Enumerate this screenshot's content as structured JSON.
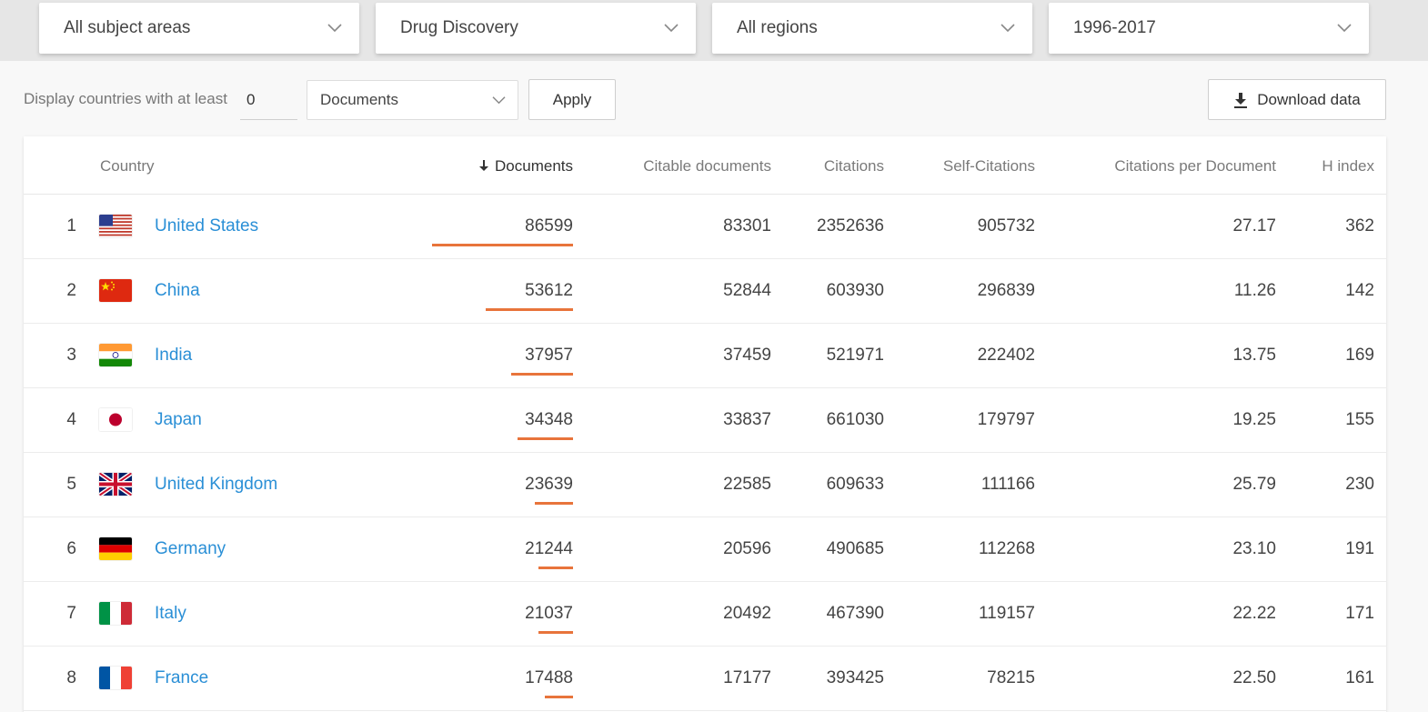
{
  "filters": {
    "subject_area": "All subject areas",
    "subject_category": "Drug Discovery",
    "region": "All regions",
    "period": "1996-2017"
  },
  "controls": {
    "min_label": "Display countries with at least",
    "min_value": "0",
    "metric": "Documents",
    "apply_label": "Apply",
    "download_label": "Download data"
  },
  "colors": {
    "accent_bar": "#e8743b",
    "link": "#2a8fd6"
  },
  "table": {
    "headers": {
      "country": "Country",
      "documents": "Documents",
      "citable": "Citable documents",
      "citations": "Citations",
      "self_citations": "Self-Citations",
      "cites_per_doc": "Citations per Document",
      "h_index": "H index"
    },
    "sort": {
      "column": "documents",
      "direction": "descending",
      "icon": "arrow-down-icon"
    },
    "rows": [
      {
        "rank": "1",
        "country": "United States",
        "flag": "us-flag-icon",
        "documents": "86599",
        "citable": "83301",
        "citations": "2352636",
        "self_citations": "905732",
        "cites_per_doc": "27.17",
        "h_index": "362"
      },
      {
        "rank": "2",
        "country": "China",
        "flag": "cn-flag-icon",
        "documents": "53612",
        "citable": "52844",
        "citations": "603930",
        "self_citations": "296839",
        "cites_per_doc": "11.26",
        "h_index": "142"
      },
      {
        "rank": "3",
        "country": "India",
        "flag": "in-flag-icon",
        "documents": "37957",
        "citable": "37459",
        "citations": "521971",
        "self_citations": "222402",
        "cites_per_doc": "13.75",
        "h_index": "169"
      },
      {
        "rank": "4",
        "country": "Japan",
        "flag": "jp-flag-icon",
        "documents": "34348",
        "citable": "33837",
        "citations": "661030",
        "self_citations": "179797",
        "cites_per_doc": "19.25",
        "h_index": "155"
      },
      {
        "rank": "5",
        "country": "United Kingdom",
        "flag": "gb-flag-icon",
        "documents": "23639",
        "citable": "22585",
        "citations": "609633",
        "self_citations": "111166",
        "cites_per_doc": "25.79",
        "h_index": "230"
      },
      {
        "rank": "6",
        "country": "Germany",
        "flag": "de-flag-icon",
        "documents": "21244",
        "citable": "20596",
        "citations": "490685",
        "self_citations": "112268",
        "cites_per_doc": "23.10",
        "h_index": "191"
      },
      {
        "rank": "7",
        "country": "Italy",
        "flag": "it-flag-icon",
        "documents": "21037",
        "citable": "20492",
        "citations": "467390",
        "self_citations": "119157",
        "cites_per_doc": "22.22",
        "h_index": "171"
      },
      {
        "rank": "8",
        "country": "France",
        "flag": "fr-flag-icon",
        "documents": "17488",
        "citable": "17177",
        "citations": "393425",
        "self_citations": "78215",
        "cites_per_doc": "22.50",
        "h_index": "161"
      }
    ]
  }
}
